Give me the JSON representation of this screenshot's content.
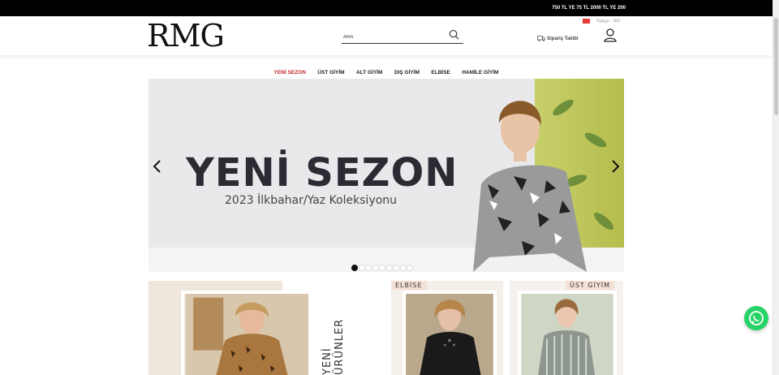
{
  "topbar": {
    "promo": "750 TL YE 75 TL 2000 TL YE 200"
  },
  "header": {
    "logo": "RMG",
    "search_placeholder": "ARA",
    "language_currency": "Türkçe - TRY",
    "order_tracking": "Sipariş Takibi",
    "icons": [
      "search-icon",
      "flag-icon",
      "truck-icon",
      "user-icon"
    ]
  },
  "nav": {
    "items": [
      {
        "label": "YENİ SEZON",
        "active": true
      },
      {
        "label": "ÜST GİYİM"
      },
      {
        "label": "ALT GİYİM"
      },
      {
        "label": "DIŞ GİYİM"
      },
      {
        "label": "ELBİSE"
      },
      {
        "label": "HAMİLE GİYİM"
      }
    ]
  },
  "hero": {
    "title": "YENİ SEZON",
    "subtitle": "2023 İlkbahar/Yaz Koleksiyonu",
    "slide_count": 9,
    "active_slide": 1
  },
  "cards": {
    "new_products": "YENİ ÜRÜNLER",
    "dress": "ELBİSE",
    "tops": "ÜST GİYİM"
  },
  "colors": {
    "accent": "#c62828",
    "whatsapp": "#25d366"
  }
}
